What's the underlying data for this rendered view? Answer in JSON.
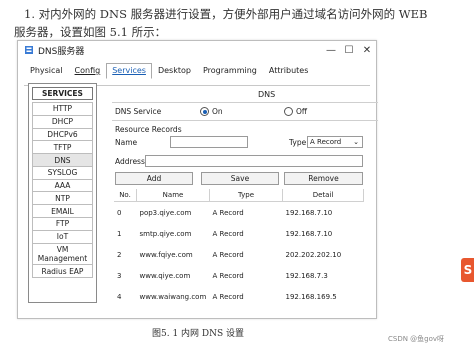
{
  "doc": {
    "line1": "1. 对内外网的 DNS 服务器进行设置，方便外部用户通过域名访问外网的 WEB",
    "line2": "服务器，设置如图 5.1 所示：",
    "caption": "图5. 1  内网 DNS 设置",
    "watermark": "CSDN @鱼gov呀"
  },
  "window": {
    "title": "DNS服务器",
    "tabs": [
      "Physical",
      "Config",
      "Services",
      "Desktop",
      "Programming",
      "Attributes"
    ],
    "active_tab": "Services"
  },
  "services": {
    "header": "SERVICES",
    "items": [
      "HTTP",
      "DHCP",
      "DHCPv6",
      "TFTP",
      "DNS",
      "SYSLOG",
      "AAA",
      "NTP",
      "EMAIL",
      "FTP",
      "IoT",
      "VM Management",
      "Radius EAP"
    ],
    "selected": "DNS"
  },
  "dns": {
    "title": "DNS",
    "service_label": "DNS Service",
    "on_label": "On",
    "off_label": "Off",
    "service_state": "On",
    "records_label": "Resource Records",
    "name_label": "Name",
    "name_value": "",
    "type_label": "Type",
    "type_value": "A Record",
    "address_label": "Address",
    "address_value": "",
    "buttons": {
      "add": "Add",
      "save": "Save",
      "remove": "Remove"
    },
    "table": {
      "headers": [
        "No.",
        "Name",
        "Type",
        "Detail"
      ],
      "rows": [
        [
          "0",
          "pop3.qiye.com",
          "A Record",
          "192.168.7.10"
        ],
        [
          "1",
          "smtp.qiye.com",
          "A Record",
          "192.168.7.10"
        ],
        [
          "2",
          "www.fqiye.com",
          "A Record",
          "202.202.202.10"
        ],
        [
          "3",
          "www.qiye.com",
          "A Record",
          "192.168.7.3"
        ],
        [
          "4",
          "www.waiwang.com",
          "A Record",
          "192.168.169.5"
        ]
      ]
    }
  },
  "colors": {
    "accent": "#1a5fb4",
    "corner_icon": "#e8572f"
  }
}
